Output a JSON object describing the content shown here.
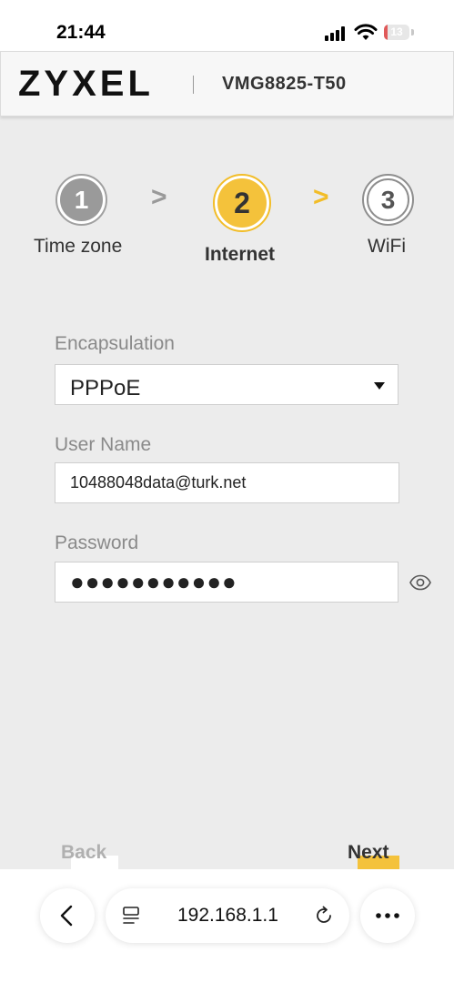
{
  "status_bar": {
    "time": "21:44",
    "battery": "13",
    "battery_level": 0.13
  },
  "header": {
    "brand": "ZYXEL",
    "model": "VMG8825-T50"
  },
  "steps": [
    {
      "number": "1",
      "label": "Time zone",
      "state": "done"
    },
    {
      "number": "2",
      "label": "Internet",
      "state": "active"
    },
    {
      "number": "3",
      "label": "WiFi",
      "state": "pending"
    }
  ],
  "step_arrows": [
    ">",
    ">"
  ],
  "form": {
    "encapsulation": {
      "label": "Encapsulation",
      "value": "PPPoE"
    },
    "username": {
      "label": "User Name",
      "value": "10488048data@turk.net"
    },
    "password": {
      "label": "Password",
      "value": "●●●●●●●●●●●"
    }
  },
  "footer": {
    "back_label": "Back",
    "next_label": "Next"
  },
  "browser": {
    "url": "192.168.1.1",
    "back_icon": "chevron-left-icon",
    "more_icon": "more-horizontal-icon"
  },
  "colors": {
    "accent": "#f4c23b",
    "inactive": "#9a9a9a",
    "background": "#ececec"
  }
}
